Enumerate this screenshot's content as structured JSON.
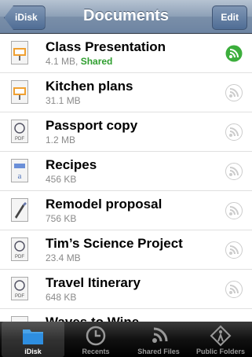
{
  "nav": {
    "title": "Documents",
    "back_label": "iDisk",
    "edit_label": "Edit"
  },
  "files": [
    {
      "name": "Class Presentation",
      "size": "4.1 MB",
      "status": "Shared",
      "icon": "keynote-icon",
      "active": true
    },
    {
      "name": "Kitchen plans",
      "size": "31.1 MB",
      "status": "",
      "icon": "keynote-icon",
      "active": false
    },
    {
      "name": "Passport copy",
      "size": "1.2 MB",
      "status": "",
      "icon": "pdf-icon",
      "active": false
    },
    {
      "name": "Recipes",
      "size": "456 KB",
      "status": "",
      "icon": "text-document-icon",
      "active": false
    },
    {
      "name": "Remodel proposal",
      "size": "756 KB",
      "status": "",
      "icon": "pages-icon",
      "active": false
    },
    {
      "name": "Tim’s Science Project",
      "size": "23.4 MB",
      "status": "",
      "icon": "pdf-icon",
      "active": false
    },
    {
      "name": "Travel Itinerary",
      "size": "648 KB",
      "status": "",
      "icon": "pdf-icon",
      "active": false
    },
    {
      "name": "Waves to Wine",
      "size": "",
      "status": "",
      "icon": "pdf-icon",
      "active": false
    }
  ],
  "tabs": [
    {
      "label": "iDisk",
      "icon": "folder-icon",
      "selected": true
    },
    {
      "label": "Recents",
      "icon": "clock-icon",
      "selected": false
    },
    {
      "label": "Shared Files",
      "icon": "broadcast-icon",
      "selected": false
    },
    {
      "label": "Public Folders",
      "icon": "person-icon",
      "selected": false
    }
  ],
  "colors": {
    "shared": "#2f9e2f",
    "nav": "#6d84a2",
    "active_share": "#3cae3c"
  }
}
